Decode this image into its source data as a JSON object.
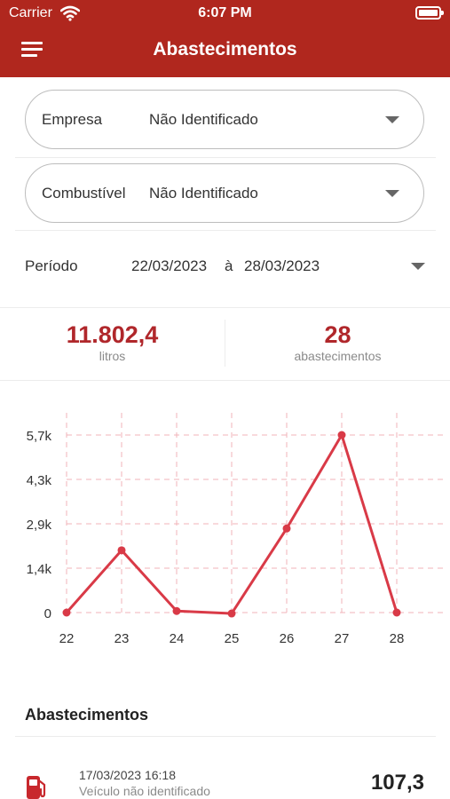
{
  "status_bar": {
    "carrier": "Carrier",
    "time": "6:07 PM"
  },
  "header": {
    "title": "Abastecimentos"
  },
  "filters": {
    "empresa": {
      "label": "Empresa",
      "value": "Não Identificado"
    },
    "combustivel": {
      "label": "Combustível",
      "value": "Não Identificado"
    },
    "periodo": {
      "label": "Período",
      "from": "22/03/2023",
      "separator": "à",
      "to": "28/03/2023"
    }
  },
  "summary": {
    "litros": {
      "value": "11.802,4",
      "label": "litros"
    },
    "abastecimentos": {
      "value": "28",
      "label": "abastecimentos"
    }
  },
  "chart_data": {
    "type": "line",
    "categories": [
      "22",
      "23",
      "24",
      "25",
      "26",
      "27",
      "28"
    ],
    "y_tick_labels": [
      "0",
      "1,4k",
      "2,9k",
      "4,3k",
      "5,7k"
    ],
    "y_tick_values": [
      0,
      1425,
      2850,
      4275,
      5700
    ],
    "ylim": [
      0,
      5700
    ],
    "series": [
      {
        "values": [
          0,
          2000,
          50,
          -30,
          2700,
          5700,
          0
        ]
      }
    ],
    "grid": true,
    "color": "#d93a47"
  },
  "list": {
    "title": "Abastecimentos",
    "items": [
      {
        "datetime": "17/03/2023 16:18",
        "vehicle": "Veículo não identificado",
        "value": "107,3",
        "icon": "fuel-pump-icon"
      }
    ]
  },
  "colors": {
    "header": "#b0271e",
    "accent": "#b0272b"
  }
}
